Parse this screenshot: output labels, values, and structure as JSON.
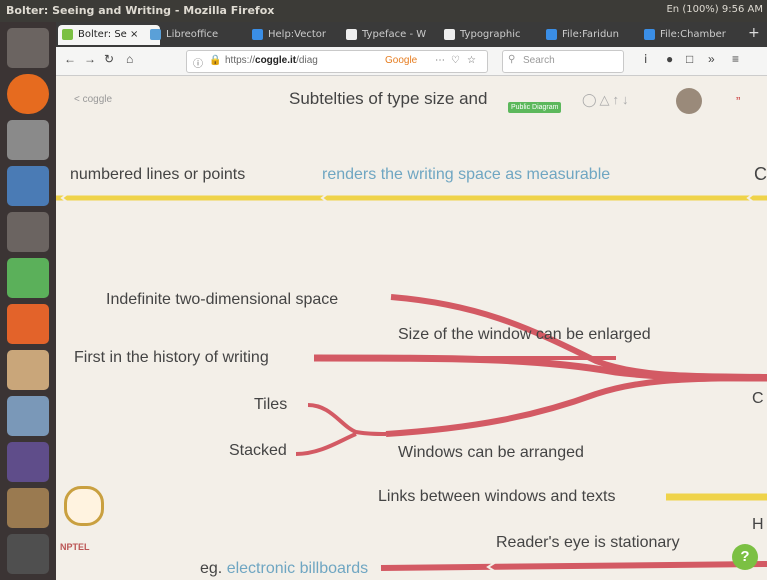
{
  "window": {
    "title": "Bolter: Seeing and Writing - Mozilla Firefox",
    "tray": "En  (100%)  9:56 AM"
  },
  "tabs": [
    {
      "label": "Bolter: Se",
      "color": "#7bc043"
    },
    {
      "label": "Libreoffice",
      "color": "#5aa0d8"
    },
    {
      "label": "Help:Vector",
      "color": "#3a8ee6"
    },
    {
      "label": "Typeface - W",
      "color": "#eee"
    },
    {
      "label": "Typographic",
      "color": "#eee"
    },
    {
      "label": "File:Faridun",
      "color": "#3a8ee6"
    },
    {
      "label": "File:Chamber",
      "color": "#3a8ee6"
    }
  ],
  "nav": {
    "url_prefix": "https://",
    "url_domain": "coggle.it",
    "url_path": "/diag",
    "search_engine": "Google",
    "search_placeholder": "Search"
  },
  "page": {
    "breadcrumb": "< coggle",
    "title": "Subtelties of type size and",
    "badge": "Public Diagram",
    "help": "?",
    "logo": "NPTEL",
    "colors": {
      "branch_red": "#d35a64",
      "branch_yellow": "#efd34a"
    }
  },
  "nodes": {
    "numbered": "numbered lines or points",
    "renders": "renders the writing space as measurable",
    "cut_c1": "C",
    "indefinite": "Indefinite two-dimensional space",
    "size_window": "Size of the window can be enlarged",
    "first_history": "First in the history of writing",
    "tiles": "Tiles",
    "cut_c2": "C",
    "stacked": "Stacked",
    "arranged": "Windows can be arranged",
    "links": "Links between windows and texts",
    "cut_h": "H",
    "readers_eye": "Reader's eye is stationary",
    "eg_prefix": "eg.",
    "eg_link": "electronic billboards"
  }
}
